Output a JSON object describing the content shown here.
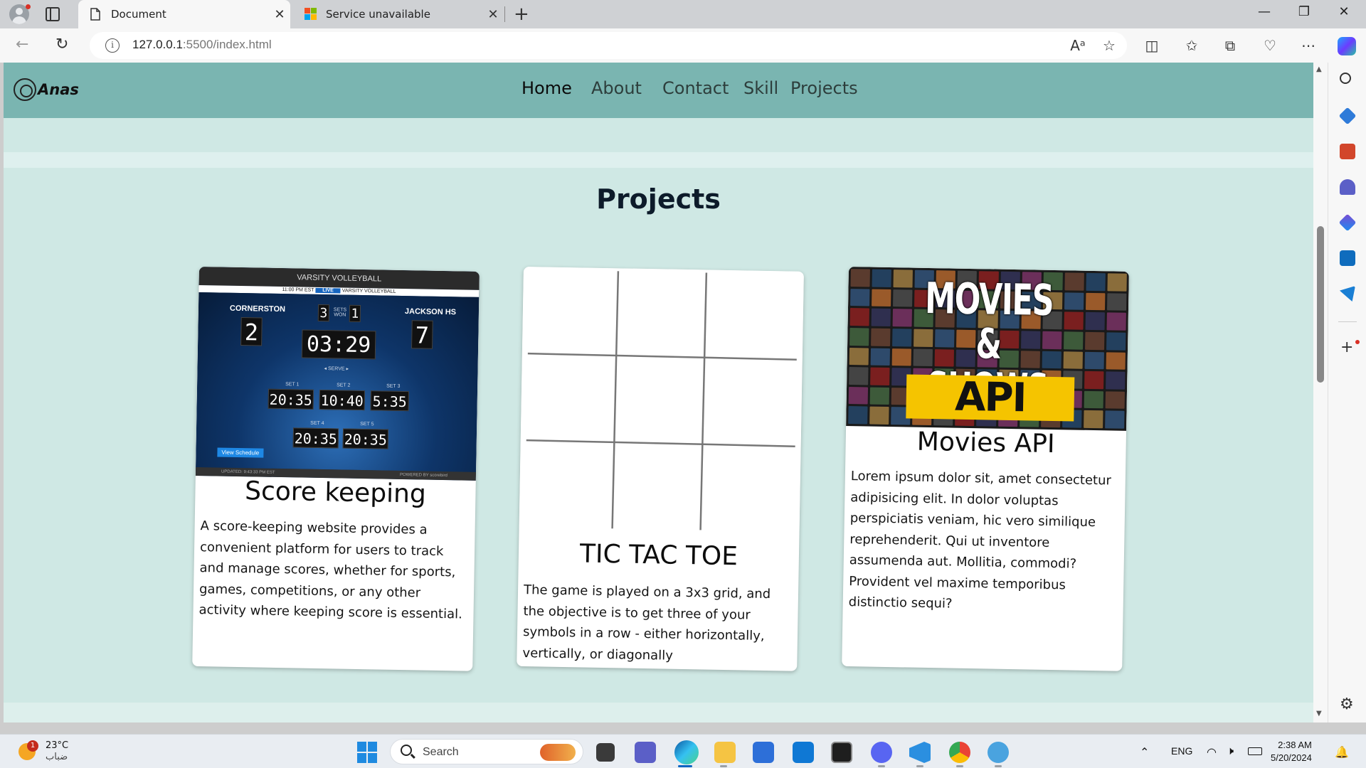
{
  "browser": {
    "tabs": [
      {
        "title": "Document",
        "active": true
      },
      {
        "title": "Service unavailable",
        "active": false
      }
    ],
    "url_host": "127.0.0.1",
    "url_rest": ":5500/index.html"
  },
  "site": {
    "logo_text": "Anas",
    "nav": [
      "Home",
      "About",
      "Contact",
      "Skill",
      "Projects"
    ],
    "section_title": "Projects",
    "projects": [
      {
        "title": "Score keeping",
        "description": "A score-keeping website provides a convenient platform for users to track and manage scores, whether for sports, games, competitions, or any other activity where keeping score is essential.",
        "image": {
          "header": "VARSITY VOLLEYBALL",
          "strip_left": "11:00 PM EST",
          "strip_live": "LIVE",
          "strip_right": "VARSITY VOLLEYBALL",
          "home_team": "CORNERSTON",
          "away_team": "JACKSON HS",
          "home_score": "2",
          "away_score": "7",
          "sets_home": "3",
          "sets_away": "1",
          "sets_label": "SETS WON",
          "clock": "03:29",
          "serve": "SERVE",
          "sets": [
            {
              "label": "SET 1",
              "value": "20:35"
            },
            {
              "label": "SET 2",
              "value": "10:40"
            },
            {
              "label": "SET 3",
              "value": "5:35"
            },
            {
              "label": "SET 4",
              "value": "20:35"
            },
            {
              "label": "SET 5",
              "value": "20:35"
            }
          ],
          "link": "View Schedule",
          "footer_left": "UPDATED: 9:43:33 PM EST",
          "footer_right": "POWERED BY scorebird"
        }
      },
      {
        "title": "TIC TAC TOE",
        "description": "The game is played on a 3x3 grid, and the objective is to get three of your symbols in a row - either horizontally, vertically, or diagonally"
      },
      {
        "title": "Movies API",
        "description": "Lorem ipsum dolor sit, amet consectetur adipisicing elit. In dolor voluptas perspiciatis veniam, hic vero similique reprehenderit. Qui ut inventore assumenda aut. Mollitia, commodi? Provident vel maxime temporibus distinctio sequi?",
        "image": {
          "line1": "MOVIES",
          "line2": "& SHOWS",
          "line3": "API"
        }
      }
    ]
  },
  "taskbar": {
    "weather_temp": "23°C",
    "weather_desc": "ضباب",
    "weather_badge": "1",
    "search_placeholder": "Search",
    "lang": "ENG",
    "time": "2:38 AM",
    "date": "5/20/2024"
  }
}
